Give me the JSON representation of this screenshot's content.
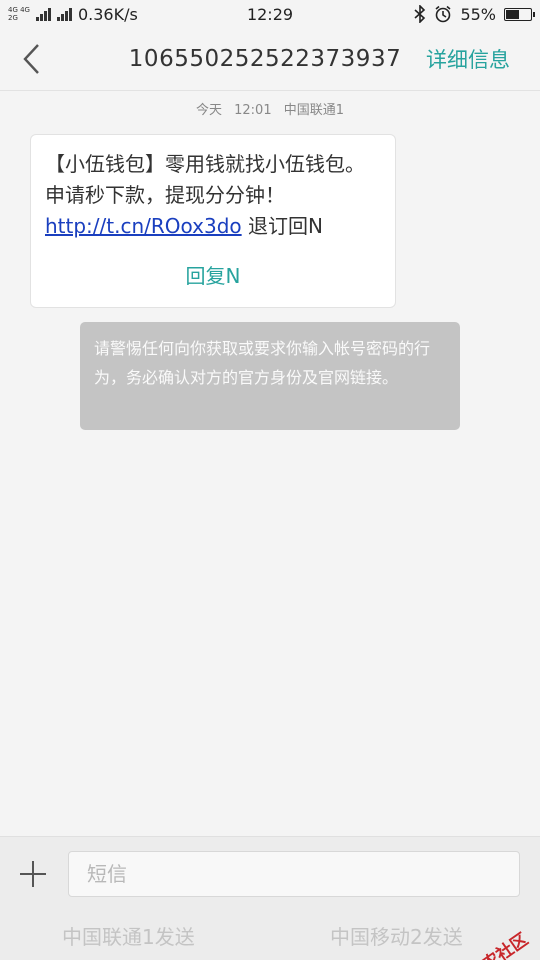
{
  "status_bar": {
    "net_tag_1": "4G 4G",
    "net_tag_2": "2G",
    "speed": "0.36K/s",
    "time": "12:29",
    "battery_percent": "55%",
    "battery_level": 0.55
  },
  "header": {
    "number": "10655025",
    "number_tail": "2522373937",
    "details_label": "详细信息"
  },
  "message": {
    "day": "今天",
    "time": "12:01",
    "carrier": "中国联通1",
    "text_before": "【小伍钱包】零用钱就找小伍钱包。申请秒下款，提现分分钟！",
    "link": "http://t.cn/ROox3do",
    "text_after": " 退订回N",
    "reply_label": "回复N"
  },
  "warning": "请警惕任何向你获取或要求你输入帐号密码的行为，务必确认对方的官方身份及官网链接。",
  "composer": {
    "placeholder": "短信",
    "send_sim1": "中国联通1发送",
    "send_sim2": "中国移动2发送"
  },
  "watermark": "卡农社区",
  "colors": {
    "accent": "#27a39e",
    "link": "#1a3fbf",
    "warning_bg": "#c4c4c4"
  }
}
